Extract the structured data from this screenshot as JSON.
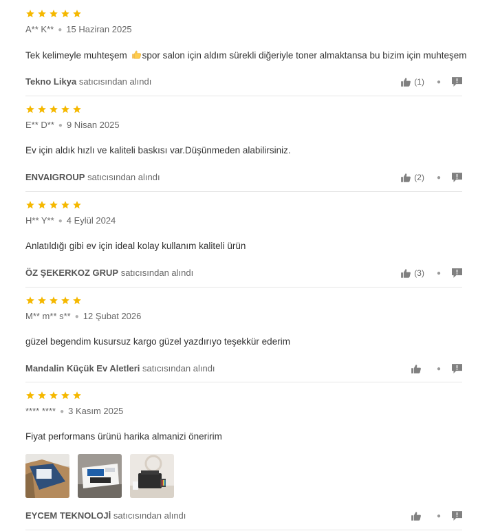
{
  "colors": {
    "star": "#f5b800",
    "text": "#333333",
    "muted": "#666666",
    "icon": "#808080",
    "divider": "#e6e6e6"
  },
  "icons": {
    "star": "star-icon",
    "like": "thumbs-up-icon",
    "report": "report-flag-icon",
    "emoji": "thumbs-up-emoji"
  },
  "reviews": [
    {
      "rating": 5,
      "author": "A** K**",
      "date": "15 Haziran 2025",
      "comment_before": "Tek kelimeyle muhteşem ",
      "comment_after": "spor salon için aldım sürekli diğeriyle toner almaktansa bu bizim için muhteşem",
      "seller": "Tekno Likya",
      "seller_suffix": "satıcısından alındı",
      "likes": "(1)"
    },
    {
      "rating": 5,
      "author": "E** D**",
      "date": "9 Nisan 2025",
      "comment": "Ev için aldık hızlı ve kaliteli baskısı var.Düşünmeden alabilirsiniz.",
      "seller": "ENVAIGROUP",
      "seller_suffix": "satıcısından alındı",
      "likes": "(2)"
    },
    {
      "rating": 5,
      "author": "H** Y**",
      "date": "4 Eylül 2024",
      "comment": "Anlatıldığı gibi ev için ideal kolay kullanım kaliteli ürün",
      "seller": "ÖZ ŞEKERKOZ GRUP",
      "seller_suffix": "satıcısından alındı",
      "likes": "(3)"
    },
    {
      "rating": 5,
      "author": "M** m** s**",
      "date": "12 Şubat 2026",
      "comment": "güzel begendim kusursuz kargo güzel yazdırıyo teşekkür ederim",
      "seller": "Mandalin Küçük Ev Aletleri",
      "seller_suffix": "satıcısından alındı",
      "likes": ""
    },
    {
      "rating": 5,
      "author": "**** ****",
      "date": "3 Kasım 2025",
      "comment": "Fiyat performans ürünü harika almanizi öneririm",
      "seller": "EYCEM TEKNOLOJİ",
      "seller_suffix": "satıcısından alındı",
      "likes": "",
      "photos": [
        "printer-box-photo",
        "printer-package-photo",
        "printer-on-table-photo"
      ]
    }
  ]
}
